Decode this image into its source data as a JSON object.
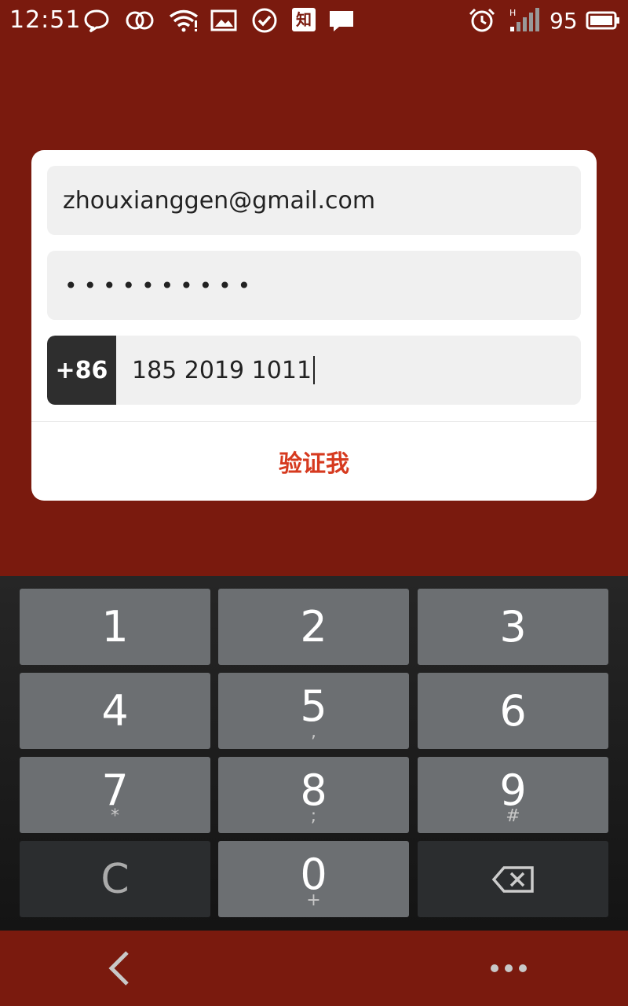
{
  "status_bar": {
    "time": "12:51",
    "zhi_label": "知",
    "battery_level": "95",
    "icons": [
      "chat-bubble-icon",
      "circles-icon",
      "wifi-icon",
      "image-icon",
      "check-circle-icon",
      "zhihu-icon",
      "message-icon",
      "alarm-icon",
      "signal-icon",
      "battery-icon"
    ]
  },
  "form": {
    "email_value": "zhouxianggen@gmail.com",
    "password_value": "••••••••••",
    "country_code": "+86",
    "phone_value": "185 2019 1011",
    "verify_label": "验证我"
  },
  "keypad": {
    "k1": {
      "num": "1",
      "sub": ""
    },
    "k2": {
      "num": "2",
      "sub": ""
    },
    "k3": {
      "num": "3",
      "sub": ""
    },
    "k4": {
      "num": "4",
      "sub": ""
    },
    "k5": {
      "num": "5",
      "sub": ","
    },
    "k6": {
      "num": "6",
      "sub": ""
    },
    "k7": {
      "num": "7",
      "sub": "*"
    },
    "k8": {
      "num": "8",
      "sub": ";"
    },
    "k9": {
      "num": "9",
      "sub": "#"
    },
    "clear": "C",
    "k0": {
      "num": "0",
      "sub": "+"
    }
  },
  "colors": {
    "background": "#7a1a0e",
    "accent": "#d63a1f",
    "key": "#6c6f72",
    "key_dark": "#2b2d2f"
  }
}
